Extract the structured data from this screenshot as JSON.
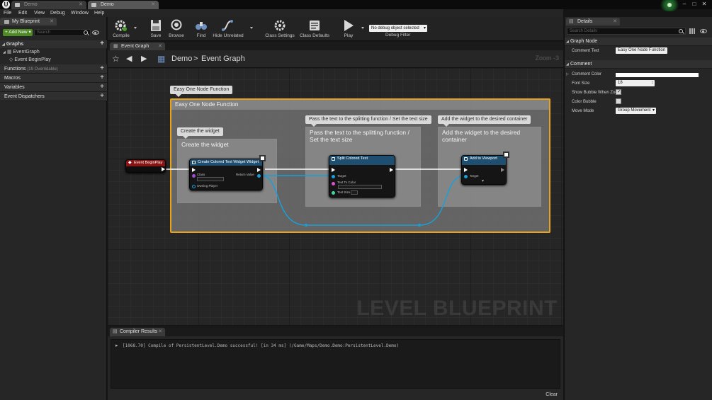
{
  "window": {
    "tabs": [
      {
        "label": "Demo",
        "active": false
      },
      {
        "label": "Demo",
        "active": true
      }
    ],
    "controls": {
      "minimize": "–",
      "restore": "□",
      "close": "✕"
    }
  },
  "menu": [
    "File",
    "Edit",
    "View",
    "Debug",
    "Window",
    "Help"
  ],
  "my_blueprint": {
    "tab_label": "My Blueprint",
    "add_new_label": "Add New",
    "search_placeholder": "Search",
    "graphs_label": "Graphs",
    "event_graph_label": "EventGraph",
    "event_begin_play_label": "Event BeginPlay",
    "sections": [
      {
        "label": "Functions",
        "sub": "(19 Overridable)"
      },
      {
        "label": "Macros",
        "sub": ""
      },
      {
        "label": "Variables",
        "sub": ""
      },
      {
        "label": "Event Dispatchers",
        "sub": ""
      }
    ]
  },
  "toolbar": {
    "compile": "Compile",
    "save": "Save",
    "browse": "Browse",
    "find": "Find",
    "hide_unrelated": "Hide Unrelated",
    "class_settings": "Class Settings",
    "class_defaults": "Class Defaults",
    "play": "Play",
    "debug_object": "No debug object selected",
    "debug_filter": "Debug Filter"
  },
  "graph_tab": {
    "label": "Event Graph"
  },
  "breadcrumb": {
    "root": "Demo",
    "separator": ">",
    "current": "Event Graph",
    "zoom": "Zoom -3"
  },
  "graph": {
    "watermark": "LEVEL BLUEPRINT",
    "outer_comment": {
      "bubble": "Easy One Node Function",
      "title": "Easy One Node Function",
      "color": "#e8a317"
    },
    "inner_comments": [
      {
        "bubble": "Create the widget",
        "title": "Create the widget"
      },
      {
        "bubble": "Pass the text to the splitting function / Set the text size",
        "title": "Pass the text to the splitting function / Set the text size"
      },
      {
        "bubble": "Add the widget to the desired container",
        "title": "Add the widget to the desired container"
      }
    ],
    "nodes": {
      "begin_play": {
        "title": "Event BeginPlay",
        "color": "#8a1414"
      },
      "create_widget": {
        "title": "Create Colored Text Widget Widget",
        "pins": {
          "class": "Class",
          "owning_player": "Owning Player",
          "return_value": "Return Value"
        },
        "color": "#1f4f70"
      },
      "split_text": {
        "title": "Split Colored Text",
        "pins": {
          "target": "Target",
          "text_to_color": "Text To Color",
          "text_size": "Text Size"
        },
        "color": "#1f4f70"
      },
      "add_to_viewport": {
        "title": "Add to Viewport",
        "pins": {
          "target": "Target"
        },
        "color": "#1f4f70"
      }
    },
    "wire_color": "#1a9fd8"
  },
  "compiler": {
    "tab_label": "Compiler Results",
    "log": "[1068.70] Compile of PersistentLevel.Demo successful! [in 34 ms] (/Game/Maps/Demo.Demo:PersistentLevel.Demo)",
    "clear_label": "Clear"
  },
  "details": {
    "tab_label": "Details",
    "search_placeholder": "Search Details",
    "graph_node_section": "Graph Node",
    "comment_text_label": "Comment Text",
    "comment_text_value": "Easy One Node Function",
    "comment_section": "Comment",
    "comment_color_label": "Comment Color",
    "font_size_label": "Font Size",
    "font_size_value": "18",
    "show_bubble_label": "Show Bubble When Zoo",
    "show_bubble_checked": true,
    "color_bubble_label": "Color Bubble",
    "color_bubble_checked": false,
    "move_mode_label": "Move Mode",
    "move_mode_value": "Group Movement"
  }
}
